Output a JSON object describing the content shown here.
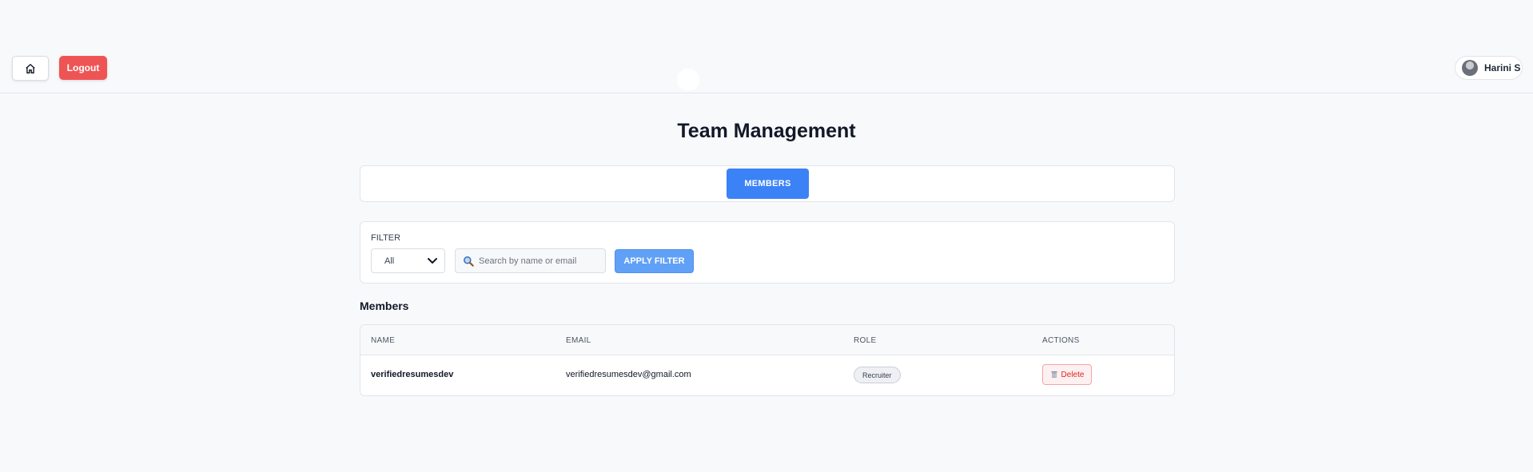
{
  "header": {
    "logout_label": "Logout",
    "user_name": "Harini S"
  },
  "page": {
    "title": "Team Management"
  },
  "tabs": [
    {
      "label": "MEMBERS",
      "active": true
    }
  ],
  "filter": {
    "label": "FILTER",
    "role_selected": "All",
    "search_placeholder": "Search by name or email",
    "search_value": "",
    "apply_label": "APPLY FILTER"
  },
  "members": {
    "section_title": "Members",
    "columns": [
      "NAME",
      "EMAIL",
      "ROLE",
      "ACTIONS"
    ],
    "rows": [
      {
        "name": "verifiedresumesdev",
        "email": "verifiedresumesdev@gmail.com",
        "role": "Recruiter",
        "action_label": "Delete"
      }
    ]
  },
  "colors": {
    "primary": "#3b82f6",
    "danger": "#ef5454",
    "background": "#f8f9fb"
  },
  "icons": {
    "home": "home-icon",
    "search": "search-icon",
    "trash": "trash-icon",
    "chevron": "chevron-down-icon"
  }
}
